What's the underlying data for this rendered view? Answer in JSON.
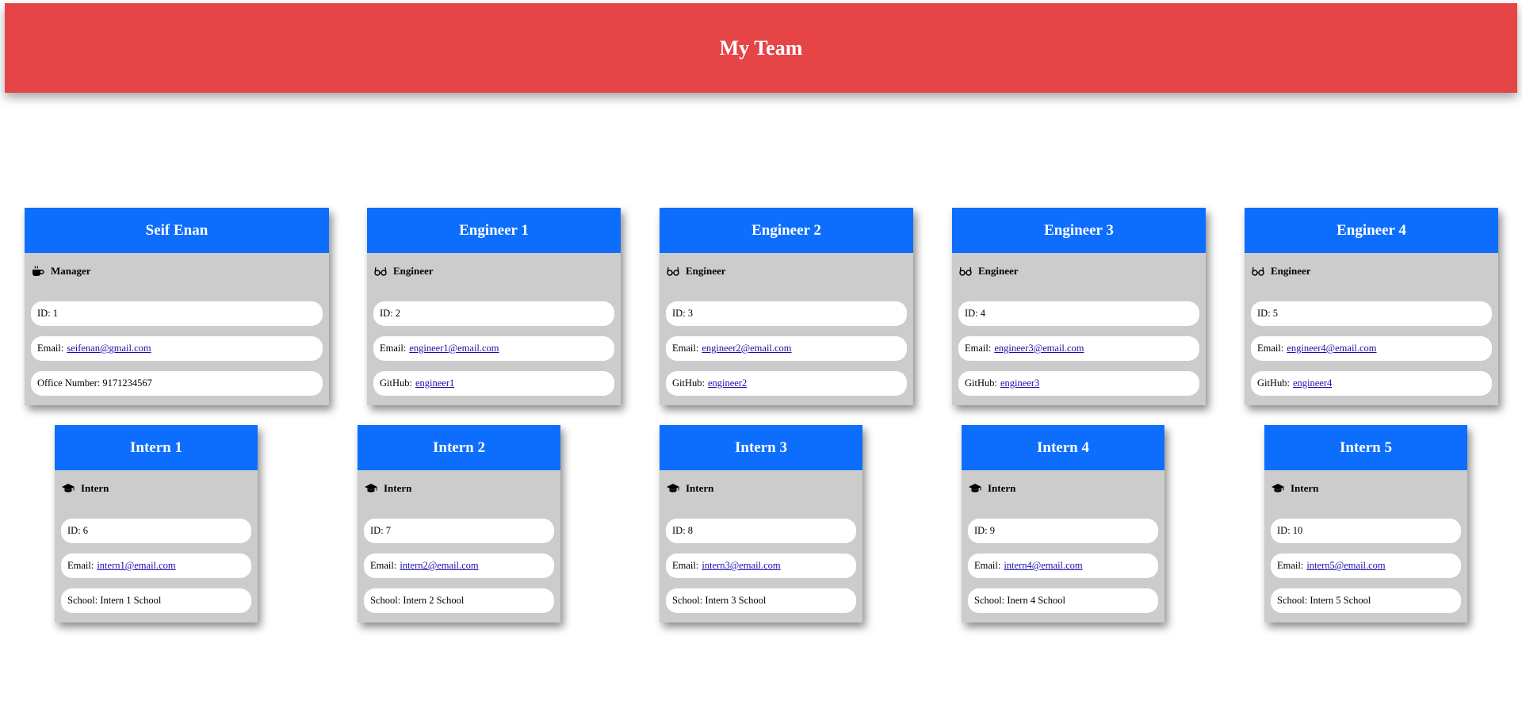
{
  "header": {
    "title": "My Team"
  },
  "roles": {
    "manager": {
      "label": "Manager",
      "icon": "coffee-icon"
    },
    "engineer": {
      "label": "Engineer",
      "icon": "glasses-icon"
    },
    "intern": {
      "label": "Intern",
      "icon": "graduation-cap-icon"
    }
  },
  "managers": [
    {
      "name": "Seif Enan",
      "id_label": "ID: 1",
      "email_label": "Email:",
      "email": "seifenan@gmail.com",
      "office_label": "Office Number: 9171234567"
    }
  ],
  "engineers": [
    {
      "name": "Engineer 1",
      "id_label": "ID: 2",
      "email_label": "Email:",
      "email": "engineer1@email.com",
      "github_label": "GitHub:",
      "github": "engineer1"
    },
    {
      "name": "Engineer 2",
      "id_label": "ID: 3",
      "email_label": "Email:",
      "email": "engineer2@email.com",
      "github_label": "GitHub:",
      "github": "engineer2"
    },
    {
      "name": "Engineer 3",
      "id_label": "ID: 4",
      "email_label": "Email:",
      "email": "engineer3@email.com",
      "github_label": "GitHub:",
      "github": "engineer3"
    },
    {
      "name": "Engineer 4",
      "id_label": "ID: 5",
      "email_label": "Email:",
      "email": "engineer4@email.com",
      "github_label": "GitHub:",
      "github": "engineer4"
    }
  ],
  "interns": [
    {
      "name": "Intern 1",
      "id_label": "ID: 6",
      "email_label": "Email:",
      "email": "intern1@email.com",
      "school_label": "School: Intern 1 School"
    },
    {
      "name": "Intern 2",
      "id_label": "ID: 7",
      "email_label": "Email:",
      "email": "intern2@email.com",
      "school_label": "School: Intern 2 School"
    },
    {
      "name": "Intern 3",
      "id_label": "ID: 8",
      "email_label": "Email:",
      "email": "intern3@email.com",
      "school_label": "School: Intern 3 School"
    },
    {
      "name": "Intern 4",
      "id_label": "ID: 9",
      "email_label": "Email:",
      "email": "intern4@email.com",
      "school_label": "School: Inern 4 School"
    },
    {
      "name": "Intern 5",
      "id_label": "ID: 10",
      "email_label": "Email:",
      "email": "intern5@email.com",
      "school_label": "School: Intern 5 School"
    }
  ],
  "colors": {
    "header_bg": "#e64547",
    "card_head_bg": "#0d6efd",
    "card_bg": "#cccccc",
    "link": "#1a0dab"
  }
}
